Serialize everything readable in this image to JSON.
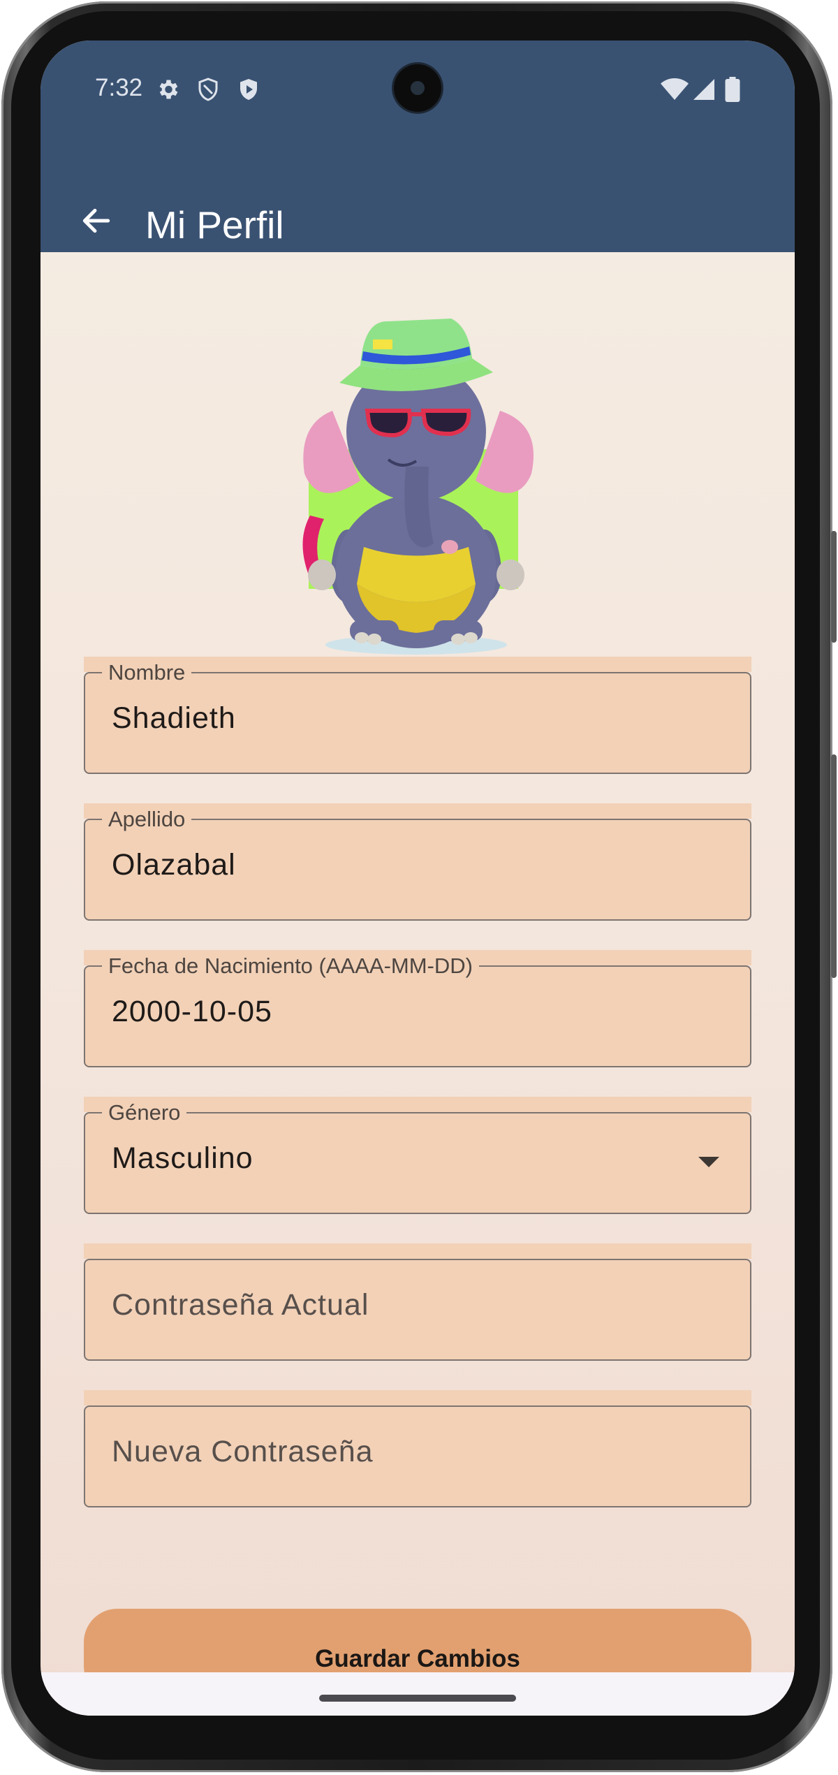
{
  "status_bar": {
    "time": "7:32",
    "left_icons": [
      "gear-icon",
      "shield-outline-icon",
      "shield-play-icon"
    ],
    "right_icons": [
      "wifi-icon",
      "cell-signal-icon",
      "battery-icon"
    ]
  },
  "app_bar": {
    "title": "Mi Perfil",
    "back_icon": "arrow-left-icon",
    "background": "#3a5272"
  },
  "profile": {
    "avatar": "elephant-mascot-illustration"
  },
  "form": {
    "nombre": {
      "label": "Nombre",
      "value": "Shadieth"
    },
    "apellido": {
      "label": "Apellido",
      "value": "Olazabal"
    },
    "fecha": {
      "label": "Fecha de Nacimiento (AAAA-MM-DD)",
      "value": "2000-10-05"
    },
    "genero": {
      "label": "Género",
      "value": "Masculino"
    },
    "password_actual": {
      "placeholder": "Contraseña Actual"
    },
    "password_nueva": {
      "placeholder": "Nueva Contraseña"
    }
  },
  "actions": {
    "save_label": "Guardar Cambios",
    "save_color": "#e2a070"
  },
  "colors": {
    "field_fill": "#f2d1b7",
    "screen_bg": "#f5ede3"
  }
}
